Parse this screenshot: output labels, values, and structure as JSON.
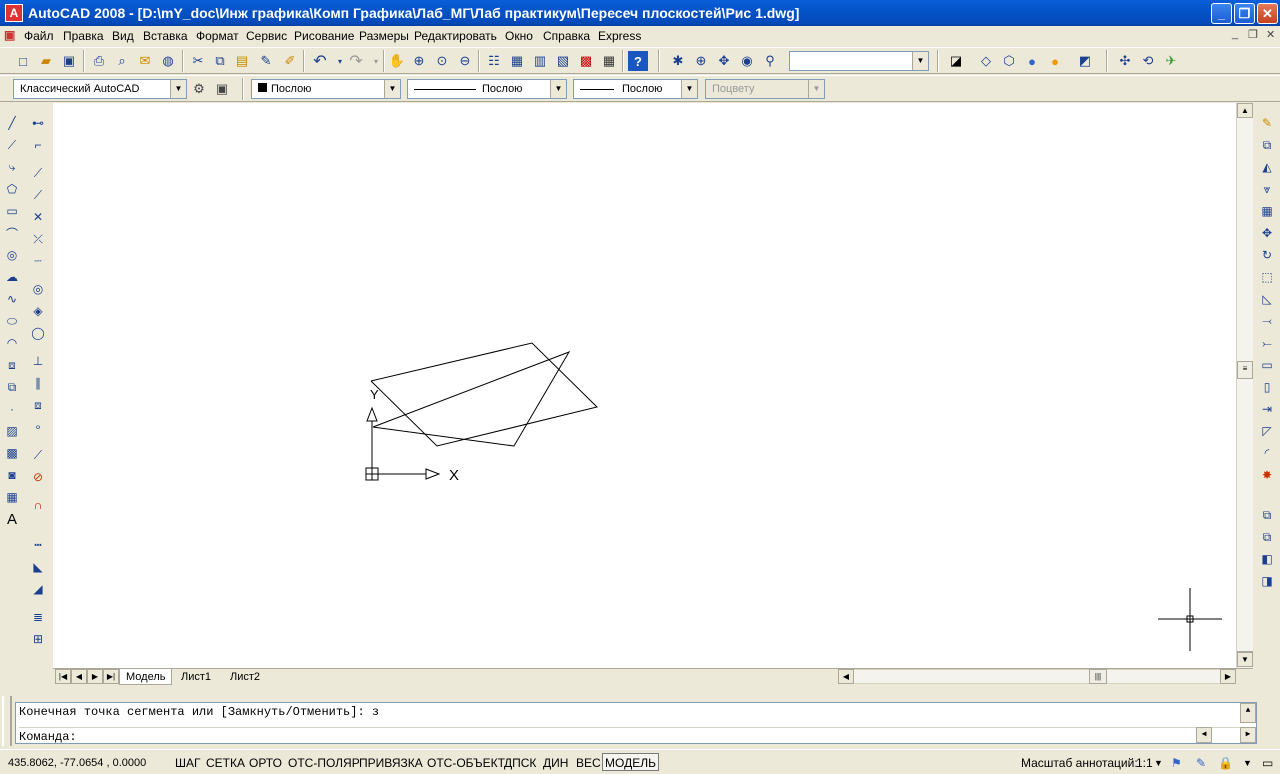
{
  "window": {
    "title": "AutoCAD 2008 - [D:\\mY_doc\\Инж графика\\Комп Графика\\Лаб_МГ\\Лаб практикум\\Пересеч плоскостей\\Рис 1.dwg]",
    "app_icon": "autocad-icon",
    "controls": [
      "minimize-icon",
      "restore-icon",
      "close-icon"
    ]
  },
  "menu": {
    "items": [
      "Файл",
      "Правка",
      "Вид",
      "Вставка",
      "Формат",
      "Сервис",
      "Рисование",
      "Размеры",
      "Редактировать",
      "Окно",
      "Справка",
      "Express"
    ]
  },
  "toolbar2": {
    "workspace": "Классический AutoCAD",
    "color": "Послою",
    "linetype": "Послою",
    "lineweight": "Послою",
    "plotstyle": "Поцвету"
  },
  "toolbar1": {
    "named_view_value": ""
  },
  "drawing": {
    "ucs_x": "X",
    "ucs_y": "Y"
  },
  "layout_tabs": [
    "Модель",
    "Лист1",
    "Лист2"
  ],
  "command": {
    "history": "Конечная точка сегмента или [Замкнуть/Отменить]: з",
    "prompt": "Команда:"
  },
  "status": {
    "coords": "435.8062, -77.0654 , 0.0000",
    "toggles": [
      {
        "label": "ШАГ",
        "on": false
      },
      {
        "label": "СЕТКА",
        "on": false
      },
      {
        "label": "ОРТО",
        "on": false
      },
      {
        "label": "ОТС-ПОЛЯР",
        "on": false
      },
      {
        "label": "ПРИВЯЗКА",
        "on": false
      },
      {
        "label": "ОТС-ОБЪЕКТ",
        "on": false
      },
      {
        "label": "ДПСК",
        "on": false
      },
      {
        "label": "ДИН",
        "on": false
      },
      {
        "label": "ВЕС",
        "on": false
      },
      {
        "label": "МОДЕЛЬ",
        "on": true
      }
    ],
    "annotation_scale_label": "Масштаб аннотаций:",
    "annotation_scale_value": "1:1"
  }
}
